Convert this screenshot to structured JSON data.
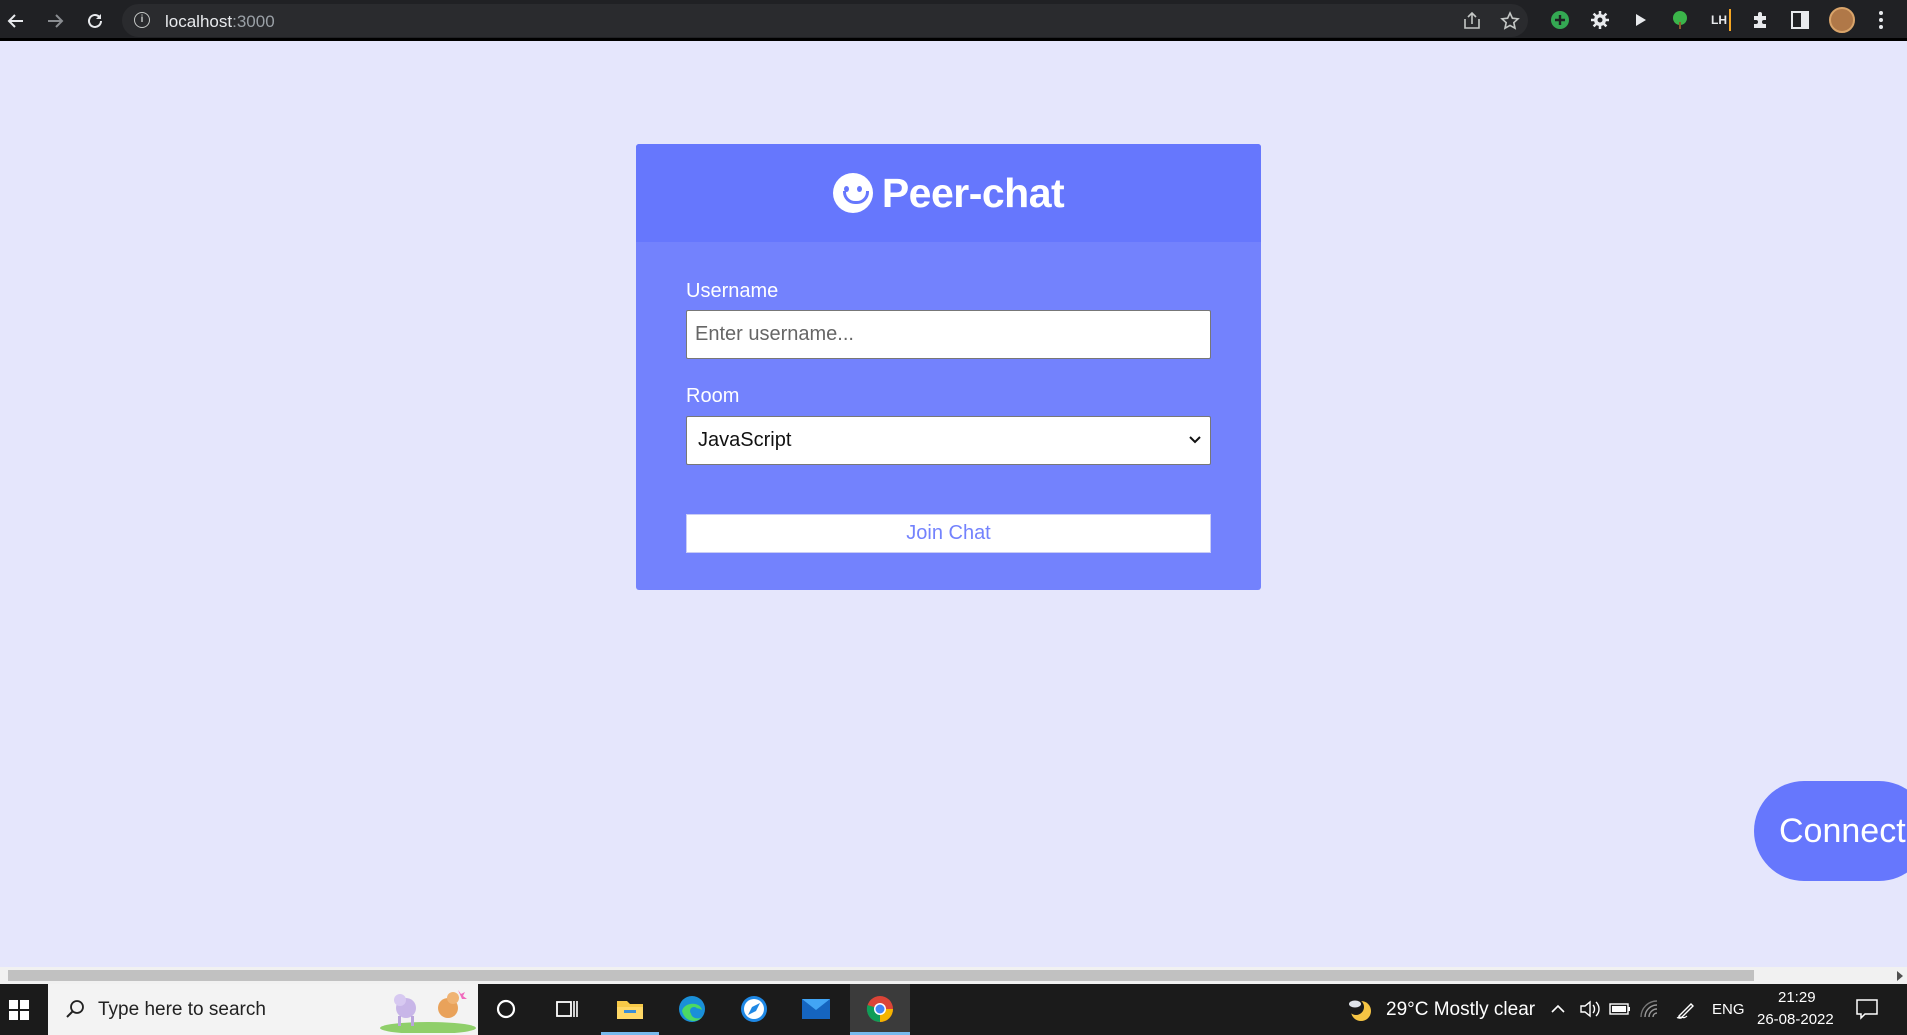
{
  "browser": {
    "url_host": "localhost",
    "url_port": ":3000",
    "extension_label": "LH"
  },
  "app": {
    "title": "Peer-chat",
    "username_label": "Username",
    "username_placeholder": "Enter username...",
    "username_value": "",
    "room_label": "Room",
    "room_selected": "JavaScript",
    "join_button": "Join Chat",
    "connect_button": "Connect"
  },
  "colors": {
    "page_bg": "#e5e6fc",
    "card_bg": "#7382fd",
    "card_header_bg": "#6677fd",
    "accent": "#6677fd"
  },
  "taskbar": {
    "search_placeholder": "Type here to search",
    "weather": "29°C  Mostly clear",
    "language": "ENG",
    "time": "21:29",
    "date": "26-08-2022",
    "apps": [
      "cortana-icon",
      "task-view-icon",
      "file-explorer-icon",
      "edge-icon",
      "safari-icon",
      "mail-icon",
      "chrome-icon"
    ]
  }
}
